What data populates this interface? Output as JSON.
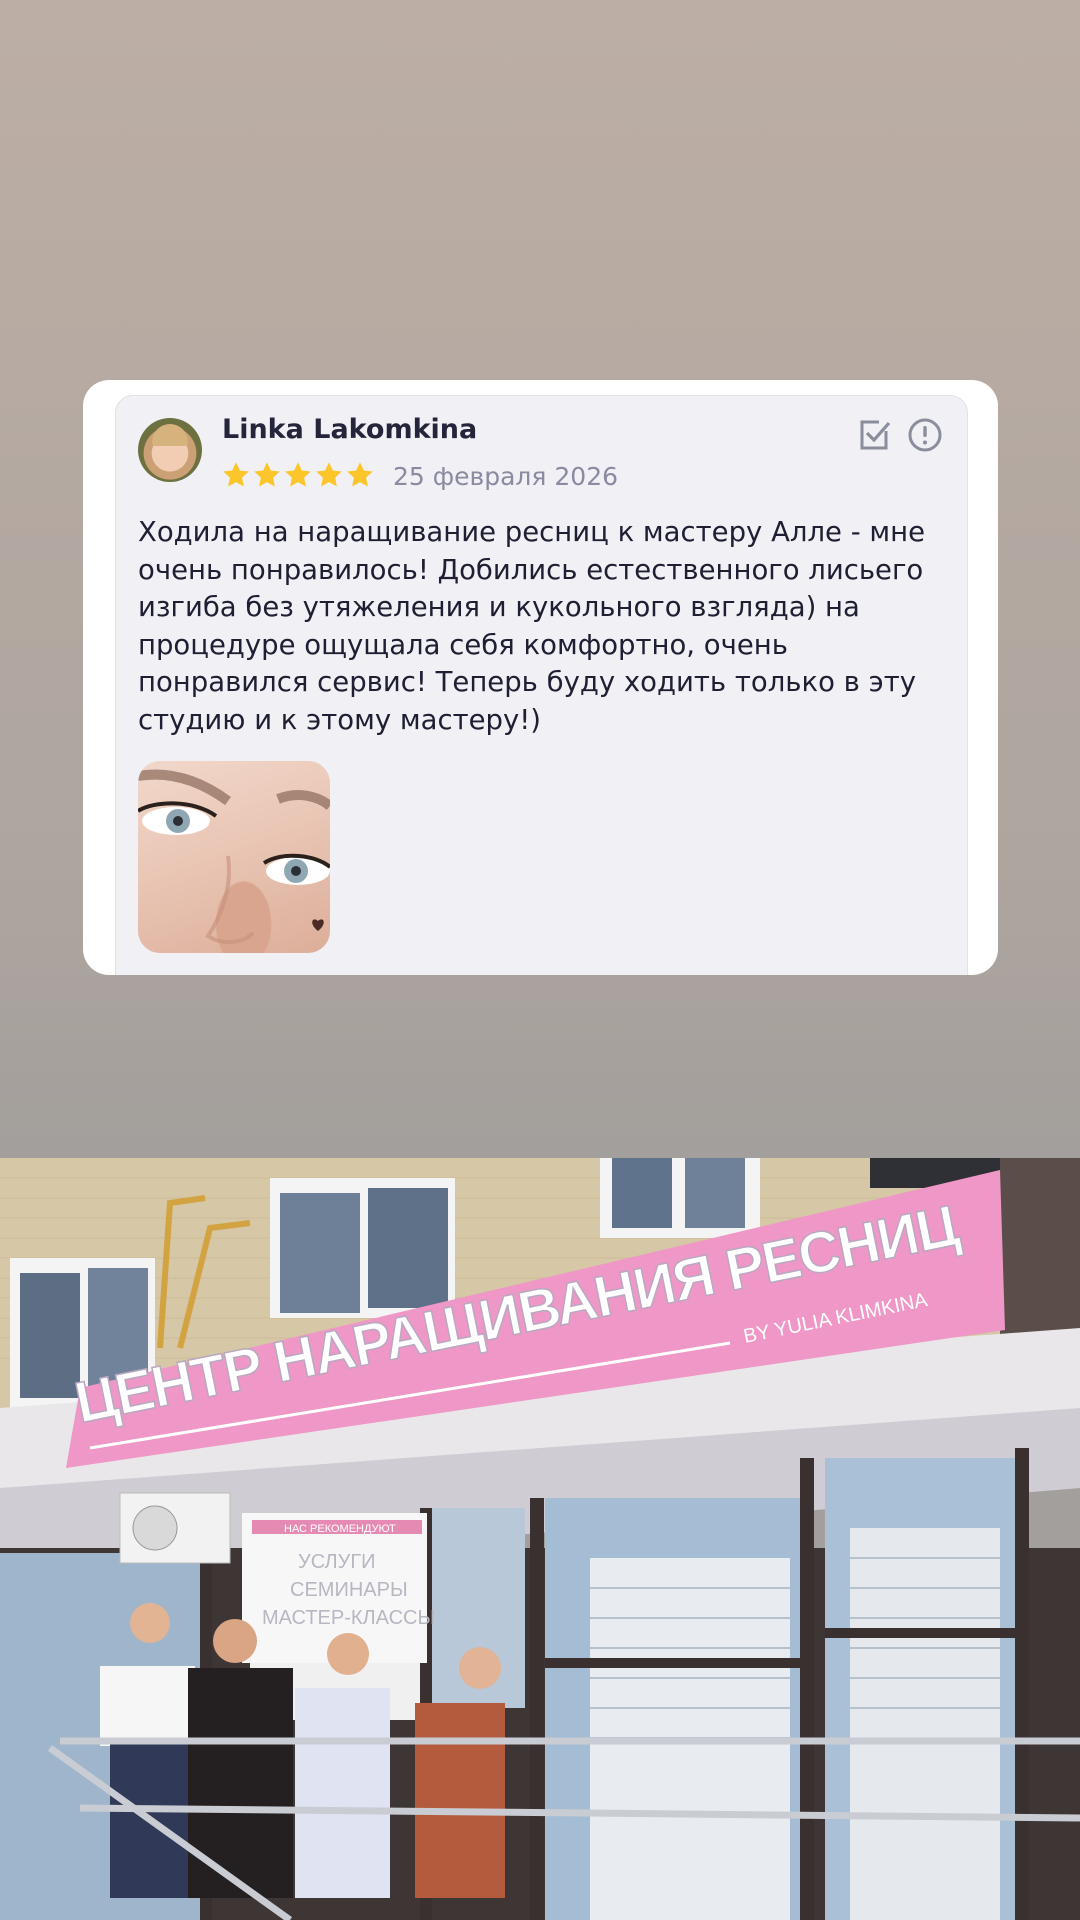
{
  "review": {
    "author": "Linka Lakomkina",
    "rating": 5,
    "rating_max": 5,
    "date": "25 февраля 2026",
    "text": "Ходила на наращивание ресниц к мастеру Алле - мне очень понравилось! Добились естественного лисьего изгиба без утяжеления и кукольного взгляда) на процедуре ощущала себя комфортно, очень понравился сервис! Теперь буду ходить только в эту студию и к этому мастеру!)",
    "icons": {
      "avatar": "user-avatar",
      "verify": "checkbox-verified-icon",
      "report": "exclamation-circle-icon",
      "star": "star-icon",
      "photo": "eye-closeup-photo"
    }
  },
  "storefront": {
    "sign_main": "ЦЕНТР НАРАЩИВАНИЯ РЕСНИЦ",
    "sign_sub": "BY YULIA KLIMKINA",
    "poster_top": "НАС РЕКОМЕНДУЮТ",
    "poster_lines": [
      "УСЛУГИ",
      "СЕМИНАРЫ",
      "МАСТЕР-КЛАССЫ"
    ],
    "colors": {
      "sign": "#ef97c6",
      "sign_text": "#ffffff",
      "brick": "#d6c7a6"
    }
  },
  "colors": {
    "star": "#fcc62a",
    "card_bg": "#f0f0f5",
    "text": "#1f1f33",
    "muted": "#8a8aa0"
  }
}
